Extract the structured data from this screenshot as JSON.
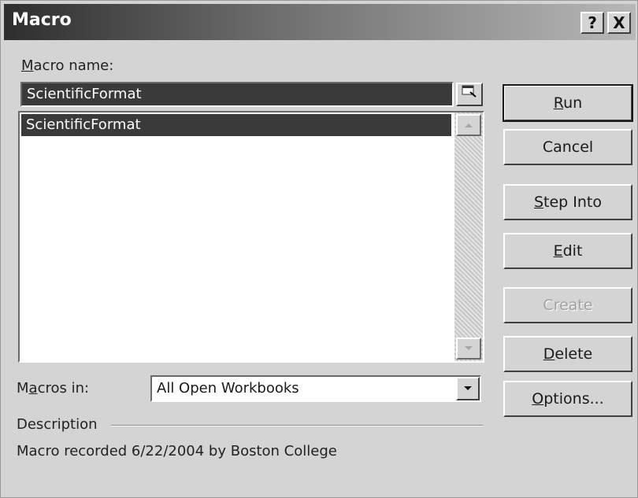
{
  "window": {
    "title": "Macro",
    "help_glyph": "?",
    "close_glyph": "X"
  },
  "macro_name": {
    "label_first": "M",
    "label_rest": "acro name:",
    "value": "ScientificFormat"
  },
  "macro_list": {
    "items": [
      "ScientificFormat"
    ],
    "selected_index": 0
  },
  "macros_in": {
    "label_first": "M",
    "label_u": "a",
    "label_rest": "cros in:",
    "value": "All Open Workbooks"
  },
  "description": {
    "label": "Description",
    "text": "Macro recorded 6/22/2004 by Boston College"
  },
  "buttons": {
    "run": {
      "u": "R",
      "rest": "un"
    },
    "cancel": {
      "text": "Cancel"
    },
    "step_into": {
      "u": "S",
      "rest": "tep Into"
    },
    "edit": {
      "u": "E",
      "rest": "dit"
    },
    "create": {
      "text": "Create"
    },
    "delete": {
      "u": "D",
      "rest": "elete"
    },
    "options": {
      "u": "O",
      "rest": "ptions..."
    }
  },
  "icons": {
    "collapse": "collapse-dialog-icon",
    "scroll_up": "scroll-up-arrow-icon",
    "scroll_down": "scroll-down-arrow-icon",
    "dropdown": "dropdown-arrow-icon"
  }
}
